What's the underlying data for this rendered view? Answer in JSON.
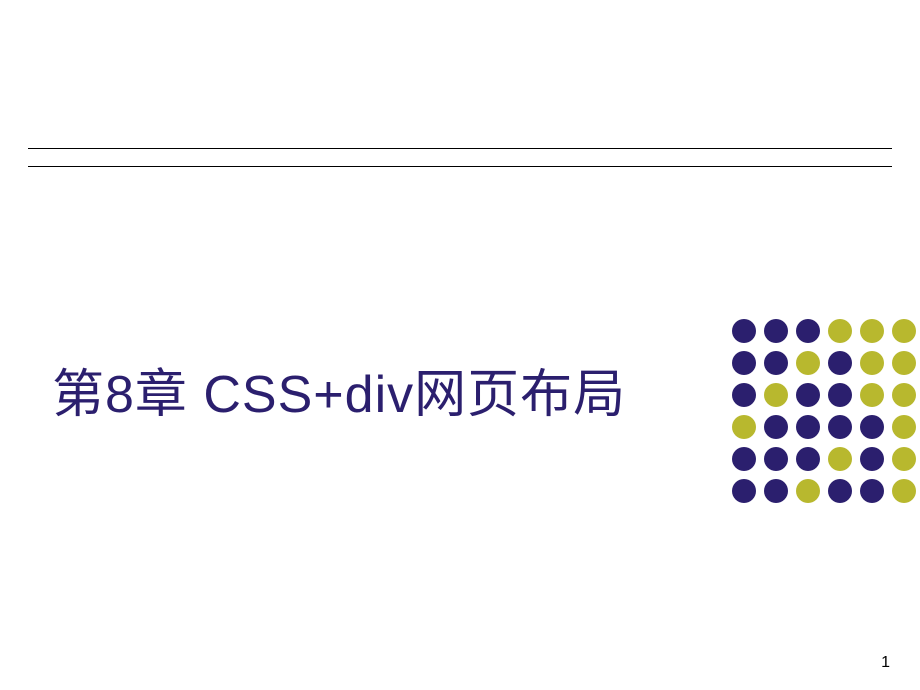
{
  "title": "第8章  CSS+div网页布局",
  "page_number": "1",
  "colors": {
    "purple": "#2b1f6e",
    "yellow": "#b8b82e"
  },
  "dot_pattern": [
    [
      "purple",
      "purple",
      "purple",
      "yellow",
      "yellow",
      "yellow"
    ],
    [
      "purple",
      "purple",
      "yellow",
      "purple",
      "yellow",
      "yellow"
    ],
    [
      "purple",
      "yellow",
      "purple",
      "purple",
      "yellow",
      "yellow"
    ],
    [
      "yellow",
      "purple",
      "purple",
      "purple",
      "purple",
      "yellow"
    ],
    [
      "purple",
      "purple",
      "purple",
      "yellow",
      "purple",
      "yellow"
    ],
    [
      "purple",
      "purple",
      "yellow",
      "purple",
      "purple",
      "yellow"
    ]
  ]
}
